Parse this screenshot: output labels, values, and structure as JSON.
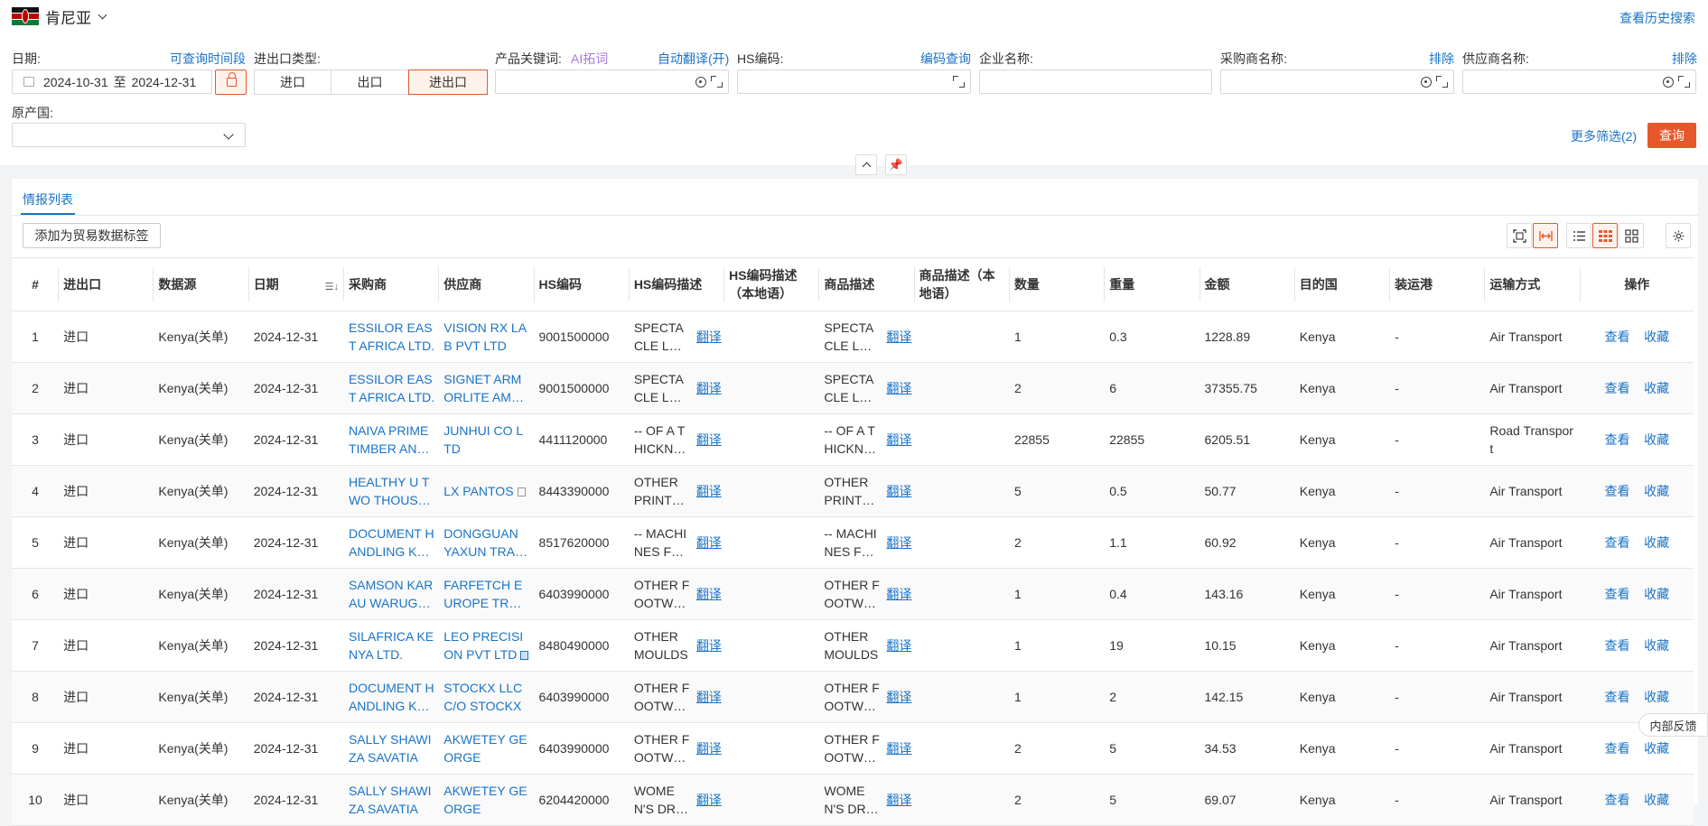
{
  "header": {
    "country": "肯尼亚",
    "history_link": "查看历史搜索"
  },
  "filters": {
    "date_label": "日期:",
    "date_range_link": "可查询时间段",
    "date_from": "2024-10-31",
    "date_sep": "至",
    "date_to": "2024-12-31",
    "trade_type_label": "进出口类型:",
    "trade_types": [
      "进口",
      "出口",
      "进出口"
    ],
    "product_label": "产品关键词:",
    "ai_expand": "AI拓词",
    "auto_translate": "自动翻译(开)",
    "hs_label": "HS编码:",
    "hs_query": "编码查询",
    "company_label": "企业名称:",
    "buyer_label": "采购商名称:",
    "buyer_exclude": "排除",
    "supplier_label": "供应商名称:",
    "supplier_exclude": "排除",
    "origin_label": "原产国:",
    "more_filters": "更多筛选(2)",
    "query_button": "查询"
  },
  "panel": {
    "tab_label": "情报列表",
    "add_tag_button": "添加为贸易数据标签"
  },
  "table": {
    "headers": [
      "#",
      "进出口",
      "数据源",
      "日期",
      "采购商",
      "供应商",
      "HS编码",
      "HS编码描述",
      "HS编码描述（本地语）",
      "商品描述",
      "商品描述（本地语）",
      "数量",
      "重量",
      "金额",
      "目的国",
      "装运港",
      "运输方式",
      "操作"
    ],
    "translate_label": "翻译",
    "view_label": "查看",
    "collect_label": "收藏",
    "rows": [
      {
        "no": "1",
        "type": "进口",
        "source": "Kenya(关单)",
        "date": "2024-12-31",
        "buyer": "ESSILOR EAST AFRICA LTD.",
        "supplier": "VISION RX LAB PVT LTD",
        "supplier_icon": "",
        "hs": "9001500000",
        "hs_desc": "SPECTACLE LENSES",
        "prod_desc": "SPECTACLE LENSES",
        "qty": "1",
        "weight": "0.3",
        "amount": "1228.89",
        "dest": "Kenya",
        "port": "-",
        "transport": "Air Transport"
      },
      {
        "no": "2",
        "type": "进口",
        "source": "Kenya(关单)",
        "date": "2024-12-31",
        "buyer": "ESSILOR EAST AFRICA LTD.",
        "supplier": "SIGNET ARMORLITE AMERICA",
        "supplier_icon": "",
        "hs": "9001500000",
        "hs_desc": "SPECTACLE LENSES",
        "prod_desc": "SPECTACLE LENSES",
        "qty": "2",
        "weight": "6",
        "amount": "37355.75",
        "dest": "Kenya",
        "port": "-",
        "transport": "Air Transport"
      },
      {
        "no": "3",
        "type": "进口",
        "source": "Kenya(关单)",
        "date": "2024-12-31",
        "buyer": "NAIVA PRIME TIMBER AND HARDWARE",
        "supplier": "JUNHUI CO LTD",
        "supplier_icon": "",
        "hs": "4411120000",
        "hs_desc": "-- OF A THICKNESS",
        "prod_desc": "-- OF A THICKNESS",
        "qty": "22855",
        "weight": "22855",
        "amount": "6205.51",
        "dest": "Kenya",
        "port": "-",
        "transport": "Road Transport"
      },
      {
        "no": "4",
        "type": "进口",
        "source": "Kenya(关单)",
        "date": "2024-12-31",
        "buyer": "HEALTHY U TWO THOUSAND",
        "supplier": "LX PANTOS",
        "supplier_icon": "grey",
        "hs": "8443390000",
        "hs_desc": "OTHER PRINTERS",
        "prod_desc": "OTHER PRINTERS",
        "qty": "5",
        "weight": "0.5",
        "amount": "50.77",
        "dest": "Kenya",
        "port": "-",
        "transport": "Air Transport"
      },
      {
        "no": "5",
        "type": "进口",
        "source": "Kenya(关单)",
        "date": "2024-12-31",
        "buyer": "DOCUMENT HANDLING KENYA",
        "supplier": "DONGGUAN YAXUN TRADING",
        "supplier_icon": "",
        "hs": "8517620000",
        "hs_desc": "-- MACHINES FOR",
        "prod_desc": "-- MACHINES FOR",
        "qty": "2",
        "weight": "1.1",
        "amount": "60.92",
        "dest": "Kenya",
        "port": "-",
        "transport": "Air Transport"
      },
      {
        "no": "6",
        "type": "进口",
        "source": "Kenya(关单)",
        "date": "2024-12-31",
        "buyer": "SAMSON KARAU WARUGURU",
        "supplier": "FARFETCH EUROPE TRADING",
        "supplier_icon": "",
        "hs": "6403990000",
        "hs_desc": "OTHER FOOTWEAR",
        "prod_desc": "OTHER FOOTWEAR",
        "qty": "1",
        "weight": "0.4",
        "amount": "143.16",
        "dest": "Kenya",
        "port": "-",
        "transport": "Air Transport"
      },
      {
        "no": "7",
        "type": "进口",
        "source": "Kenya(关单)",
        "date": "2024-12-31",
        "buyer": "SILAFRICA KENYA LTD.",
        "supplier": "LEO PRECISION PVT LTD",
        "supplier_icon": "blue",
        "hs": "8480490000",
        "hs_desc": "OTHER MOULDS",
        "prod_desc": "OTHER MOULDS",
        "qty": "1",
        "weight": "19",
        "amount": "10.15",
        "dest": "Kenya",
        "port": "-",
        "transport": "Air Transport"
      },
      {
        "no": "8",
        "type": "进口",
        "source": "Kenya(关单)",
        "date": "2024-12-31",
        "buyer": "DOCUMENT HANDLING KENYA",
        "supplier": "STOCKX LLC C/O STOCKX",
        "supplier_icon": "",
        "hs": "6403990000",
        "hs_desc": "OTHER FOOTWEAR",
        "prod_desc": "OTHER FOOTWEAR",
        "qty": "1",
        "weight": "2",
        "amount": "142.15",
        "dest": "Kenya",
        "port": "-",
        "transport": "Air Transport"
      },
      {
        "no": "9",
        "type": "进口",
        "source": "Kenya(关单)",
        "date": "2024-12-31",
        "buyer": "SALLY SHAWIZA SAVATIA",
        "supplier": "AKWETEY GEORGE",
        "supplier_icon": "",
        "hs": "6403990000",
        "hs_desc": "OTHER FOOTWEAR",
        "prod_desc": "OTHER FOOTWEAR",
        "qty": "2",
        "weight": "5",
        "amount": "34.53",
        "dest": "Kenya",
        "port": "-",
        "transport": "Air Transport"
      },
      {
        "no": "10",
        "type": "进口",
        "source": "Kenya(关单)",
        "date": "2024-12-31",
        "buyer": "SALLY SHAWIZA SAVATIA",
        "supplier": "AKWETEY GEORGE",
        "supplier_icon": "",
        "hs": "6204420000",
        "hs_desc": "WOMEN'S DRESSES",
        "prod_desc": "WOMEN'S DRESSES",
        "qty": "2",
        "weight": "5",
        "amount": "69.07",
        "dest": "Kenya",
        "port": "-",
        "transport": "Air Transport"
      }
    ]
  },
  "feedback": "内部反馈",
  "colors": {
    "accent": "#e8572a",
    "link": "#1a73c8"
  }
}
